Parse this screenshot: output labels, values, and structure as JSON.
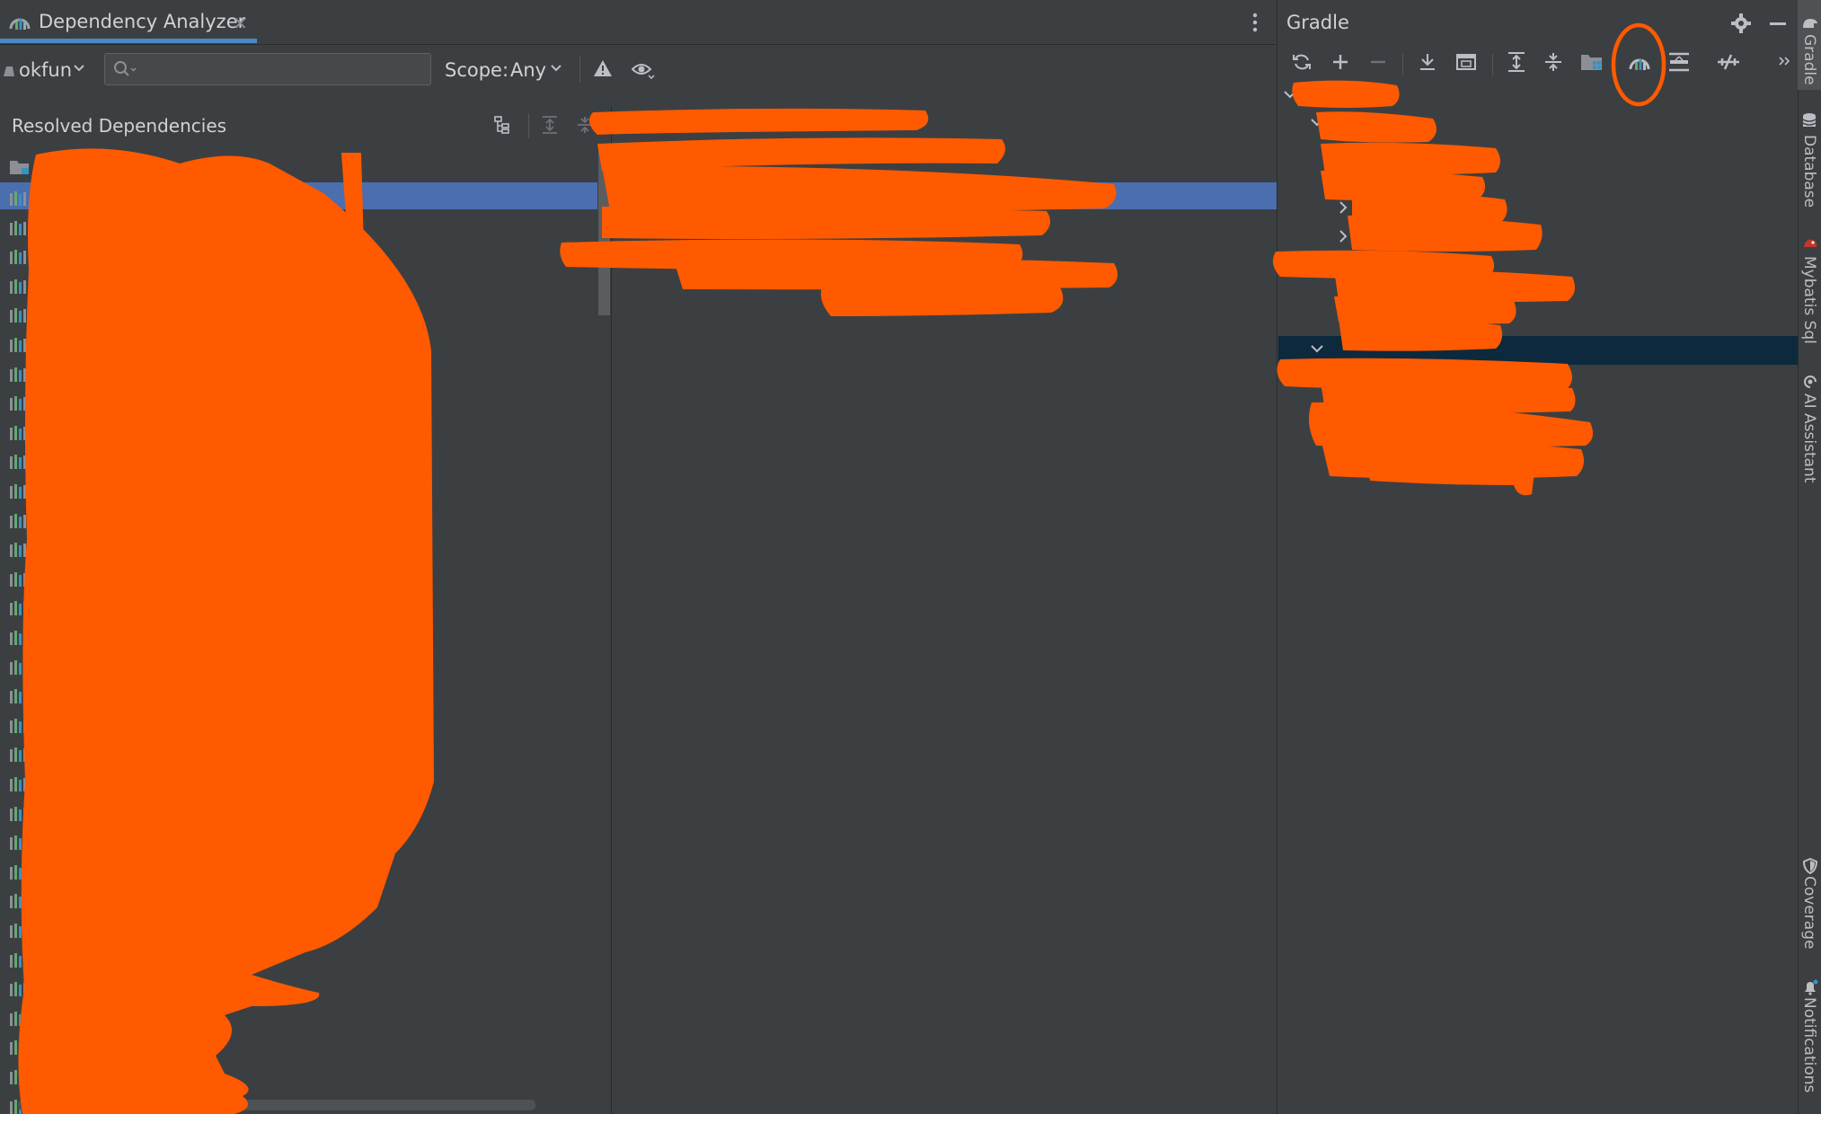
{
  "dependency_analyzer": {
    "tab_title": "Dependency Analyzer",
    "module": "okfun",
    "search": {
      "value": "",
      "placeholder": ""
    },
    "scope_label": "Scope:",
    "scope_value": "Any",
    "resolved_title": "Resolved Dependencies"
  },
  "gradle": {
    "title": "Gradle",
    "toolbar_icons": [
      "reload-icon",
      "add-icon",
      "remove-icon",
      "download-sources-icon",
      "execute-task-icon",
      "expand-all-icon",
      "collapse-all-icon",
      "group-modules-icon",
      "analyze-dependencies-icon",
      "toggle-offline-icon",
      "toggle-task-icon",
      "more-icon"
    ]
  },
  "right_stripe": {
    "items": [
      "Gradle",
      "Database",
      "Mybatis Sql",
      "AI Assistant",
      "Coverage",
      "Notifications"
    ]
  },
  "colors": {
    "panel_bg": "#3c3f41",
    "selection": "#4b6eaf",
    "selection_inactive": "#0d293e",
    "redaction": "#ff5a00",
    "tab_underline": "#4a88c7"
  }
}
